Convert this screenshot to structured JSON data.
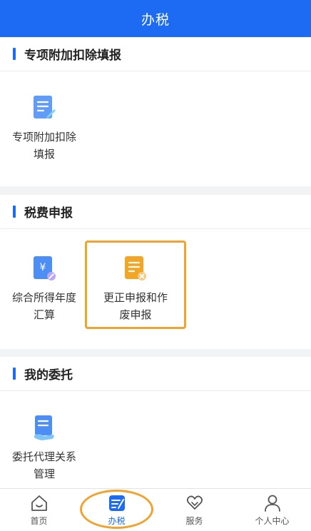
{
  "header": {
    "title": "办税"
  },
  "sections": [
    {
      "title": "专项附加扣除填报",
      "items": [
        {
          "label": "专项附加扣除填报",
          "icon": "document-edit-icon"
        }
      ]
    },
    {
      "title": "税费申报",
      "items": [
        {
          "label": "综合所得年度汇算",
          "icon": "yuan-document-icon"
        },
        {
          "label": "更正申报和作废申报",
          "icon": "document-cancel-icon"
        }
      ]
    },
    {
      "title": "我的委托",
      "items": [
        {
          "label": "委托代理关系管理",
          "icon": "document-hand-icon"
        }
      ]
    }
  ],
  "tabbar": {
    "items": [
      {
        "label": "首页",
        "icon": "home-icon",
        "active": false
      },
      {
        "label": "办税",
        "icon": "tax-edit-icon",
        "active": true
      },
      {
        "label": "服务",
        "icon": "heart-hand-icon",
        "active": false
      },
      {
        "label": "个人中心",
        "icon": "user-icon",
        "active": false
      }
    ]
  },
  "colors": {
    "primary": "#1c6bf2",
    "highlight": "#f0a330",
    "tile_orange": "#f5a524"
  }
}
